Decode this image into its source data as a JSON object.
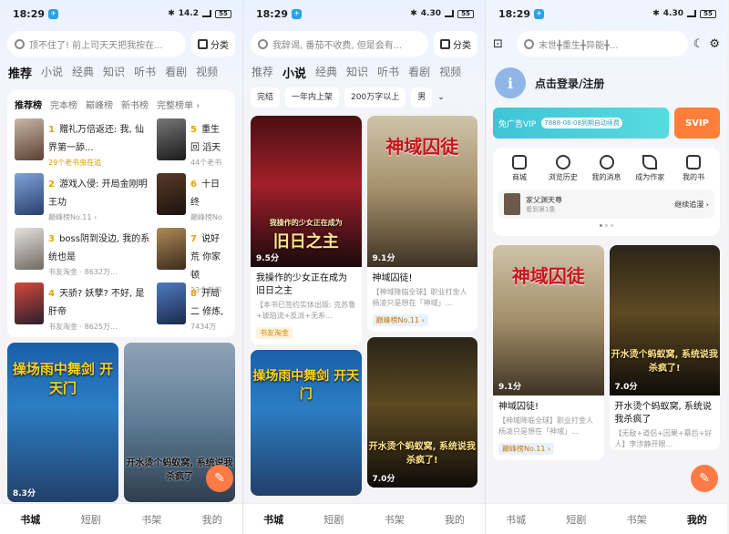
{
  "status": {
    "time": "18:29",
    "speed": "14.2",
    "speed2": "4.30",
    "battery": "55"
  },
  "p1": {
    "search_placeholder": "顶不住了! 前上司天天把我按在...",
    "cat_label": "分类",
    "tabs": [
      "推荐",
      "小说",
      "经典",
      "知识",
      "听书",
      "看剧",
      "视频"
    ],
    "rank_tabs": [
      "推荐榜",
      "完本榜",
      "巅峰榜",
      "新书榜",
      "完整榜单 ›"
    ],
    "rank_left": [
      {
        "no": "1",
        "title": "赠礼万倍返还: 我, 仙界第一舔...",
        "meta": "29个老书虫在追"
      },
      {
        "no": "2",
        "title": "游戏入侵: 开局金刚明王功",
        "meta": "巅峰榜No.11 ›"
      },
      {
        "no": "3",
        "title": "boss阴到没边, 我的系统也是",
        "meta": "书友淘金 · 8632万..."
      },
      {
        "no": "4",
        "title": "天骄? 妖孽? 不好, 是肝帝",
        "meta": "书友淘金 · 8625万..."
      }
    ],
    "rank_right": [
      {
        "no": "5",
        "title": "重生回 滔天",
        "meta": "44个老书"
      },
      {
        "no": "6",
        "title": "十日终",
        "meta": "巅峰榜No"
      },
      {
        "no": "7",
        "title": "说好荒 你家顿",
        "meta": "23个老书"
      },
      {
        "no": "8",
        "title": "开局二 修炼,",
        "meta": "7434万"
      }
    ],
    "cover1_score": "8.3分",
    "cover1_title": "操场雨中舞剑 开天门",
    "cover2_title": "开水烫个蚂蚁窝, 系统说我杀疯了"
  },
  "p2": {
    "search_placeholder": "我辞谒, 番茄不收费, 但是会有...",
    "cat_label": "分类",
    "tabs": [
      "推荐",
      "小说",
      "经典",
      "知识",
      "听书",
      "看剧",
      "视频"
    ],
    "filters": [
      "完结",
      "一年内上架",
      "200万字以上",
      "男"
    ],
    "book1": {
      "score": "9.5分",
      "cover_title": "旧日之主",
      "cover_sub": "我操作的少女正在成为",
      "title": "我操作的少女正在成为旧日之主",
      "desc": "【本书已签约实体出版: 克苏鲁+琥珀流+反派+无系...",
      "tag": "书友淘金"
    },
    "book2": {
      "score": "9.1分",
      "cover_title": "神域囚徒",
      "title": "神域囚徒!",
      "desc": "【神域降临全球】职业打金人杨凌只是想在「神域」...",
      "tag": "巅峰榜No.11 ›"
    },
    "book3": {
      "cover_title": "操场雨中舞剑 开天门"
    },
    "book4": {
      "score": "7.0分",
      "cover_title": "开水烫个蚂蚁窝, 系统说我杀疯了!"
    }
  },
  "p3": {
    "search_placeholder": "末世╋重生╋异能╋...",
    "login": "点击登录/注册",
    "vip_label": "免广告VIP",
    "vip_small": "7888-08-08到期自动续费",
    "svip_label": "SVIP",
    "services": [
      "商城",
      "浏览历史",
      "我的消息",
      "成为作家",
      "我的书"
    ],
    "recent_name": "家父渊天尊",
    "recent_chapter": "看到第1集",
    "recent_btn": "继续追漫 ›",
    "book1": {
      "score": "9.1分",
      "cover_title": "神域囚徒",
      "title": "神域囚徒!",
      "desc": "【神域降临全球】职业打金人杨凌只是想在「神域」...",
      "tag": "巅峰榜No.11 ›"
    },
    "book2": {
      "score": "7.0分",
      "cover_title": "开水烫个蚂蚁窝, 系统说我杀疯了!",
      "title": "开水烫个蚂蚁窝, 系统说我杀疯了",
      "desc": "【无敌+道侣+因果+幕后+好人】李涉静开眼..."
    }
  },
  "nav": [
    "书城",
    "短剧",
    "书架",
    "我的"
  ]
}
